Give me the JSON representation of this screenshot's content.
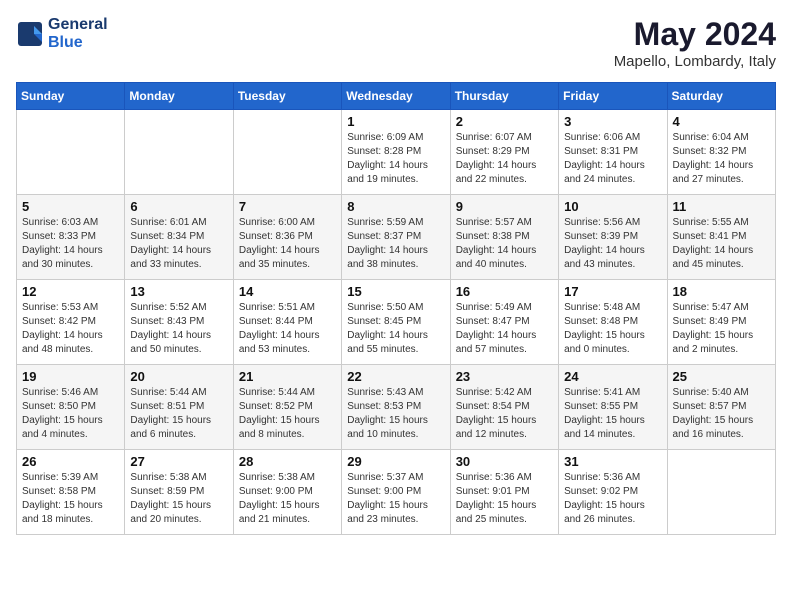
{
  "logo": {
    "line1": "General",
    "line2": "Blue"
  },
  "title": {
    "month_year": "May 2024",
    "location": "Mapello, Lombardy, Italy"
  },
  "headers": [
    "Sunday",
    "Monday",
    "Tuesday",
    "Wednesday",
    "Thursday",
    "Friday",
    "Saturday"
  ],
  "weeks": [
    [
      {
        "day": "",
        "info": ""
      },
      {
        "day": "",
        "info": ""
      },
      {
        "day": "",
        "info": ""
      },
      {
        "day": "1",
        "info": "Sunrise: 6:09 AM\nSunset: 8:28 PM\nDaylight: 14 hours\nand 19 minutes."
      },
      {
        "day": "2",
        "info": "Sunrise: 6:07 AM\nSunset: 8:29 PM\nDaylight: 14 hours\nand 22 minutes."
      },
      {
        "day": "3",
        "info": "Sunrise: 6:06 AM\nSunset: 8:31 PM\nDaylight: 14 hours\nand 24 minutes."
      },
      {
        "day": "4",
        "info": "Sunrise: 6:04 AM\nSunset: 8:32 PM\nDaylight: 14 hours\nand 27 minutes."
      }
    ],
    [
      {
        "day": "5",
        "info": "Sunrise: 6:03 AM\nSunset: 8:33 PM\nDaylight: 14 hours\nand 30 minutes."
      },
      {
        "day": "6",
        "info": "Sunrise: 6:01 AM\nSunset: 8:34 PM\nDaylight: 14 hours\nand 33 minutes."
      },
      {
        "day": "7",
        "info": "Sunrise: 6:00 AM\nSunset: 8:36 PM\nDaylight: 14 hours\nand 35 minutes."
      },
      {
        "day": "8",
        "info": "Sunrise: 5:59 AM\nSunset: 8:37 PM\nDaylight: 14 hours\nand 38 minutes."
      },
      {
        "day": "9",
        "info": "Sunrise: 5:57 AM\nSunset: 8:38 PM\nDaylight: 14 hours\nand 40 minutes."
      },
      {
        "day": "10",
        "info": "Sunrise: 5:56 AM\nSunset: 8:39 PM\nDaylight: 14 hours\nand 43 minutes."
      },
      {
        "day": "11",
        "info": "Sunrise: 5:55 AM\nSunset: 8:41 PM\nDaylight: 14 hours\nand 45 minutes."
      }
    ],
    [
      {
        "day": "12",
        "info": "Sunrise: 5:53 AM\nSunset: 8:42 PM\nDaylight: 14 hours\nand 48 minutes."
      },
      {
        "day": "13",
        "info": "Sunrise: 5:52 AM\nSunset: 8:43 PM\nDaylight: 14 hours\nand 50 minutes."
      },
      {
        "day": "14",
        "info": "Sunrise: 5:51 AM\nSunset: 8:44 PM\nDaylight: 14 hours\nand 53 minutes."
      },
      {
        "day": "15",
        "info": "Sunrise: 5:50 AM\nSunset: 8:45 PM\nDaylight: 14 hours\nand 55 minutes."
      },
      {
        "day": "16",
        "info": "Sunrise: 5:49 AM\nSunset: 8:47 PM\nDaylight: 14 hours\nand 57 minutes."
      },
      {
        "day": "17",
        "info": "Sunrise: 5:48 AM\nSunset: 8:48 PM\nDaylight: 15 hours\nand 0 minutes."
      },
      {
        "day": "18",
        "info": "Sunrise: 5:47 AM\nSunset: 8:49 PM\nDaylight: 15 hours\nand 2 minutes."
      }
    ],
    [
      {
        "day": "19",
        "info": "Sunrise: 5:46 AM\nSunset: 8:50 PM\nDaylight: 15 hours\nand 4 minutes."
      },
      {
        "day": "20",
        "info": "Sunrise: 5:44 AM\nSunset: 8:51 PM\nDaylight: 15 hours\nand 6 minutes."
      },
      {
        "day": "21",
        "info": "Sunrise: 5:44 AM\nSunset: 8:52 PM\nDaylight: 15 hours\nand 8 minutes."
      },
      {
        "day": "22",
        "info": "Sunrise: 5:43 AM\nSunset: 8:53 PM\nDaylight: 15 hours\nand 10 minutes."
      },
      {
        "day": "23",
        "info": "Sunrise: 5:42 AM\nSunset: 8:54 PM\nDaylight: 15 hours\nand 12 minutes."
      },
      {
        "day": "24",
        "info": "Sunrise: 5:41 AM\nSunset: 8:55 PM\nDaylight: 15 hours\nand 14 minutes."
      },
      {
        "day": "25",
        "info": "Sunrise: 5:40 AM\nSunset: 8:57 PM\nDaylight: 15 hours\nand 16 minutes."
      }
    ],
    [
      {
        "day": "26",
        "info": "Sunrise: 5:39 AM\nSunset: 8:58 PM\nDaylight: 15 hours\nand 18 minutes."
      },
      {
        "day": "27",
        "info": "Sunrise: 5:38 AM\nSunset: 8:59 PM\nDaylight: 15 hours\nand 20 minutes."
      },
      {
        "day": "28",
        "info": "Sunrise: 5:38 AM\nSunset: 9:00 PM\nDaylight: 15 hours\nand 21 minutes."
      },
      {
        "day": "29",
        "info": "Sunrise: 5:37 AM\nSunset: 9:00 PM\nDaylight: 15 hours\nand 23 minutes."
      },
      {
        "day": "30",
        "info": "Sunrise: 5:36 AM\nSunset: 9:01 PM\nDaylight: 15 hours\nand 25 minutes."
      },
      {
        "day": "31",
        "info": "Sunrise: 5:36 AM\nSunset: 9:02 PM\nDaylight: 15 hours\nand 26 minutes."
      },
      {
        "day": "",
        "info": ""
      }
    ]
  ]
}
